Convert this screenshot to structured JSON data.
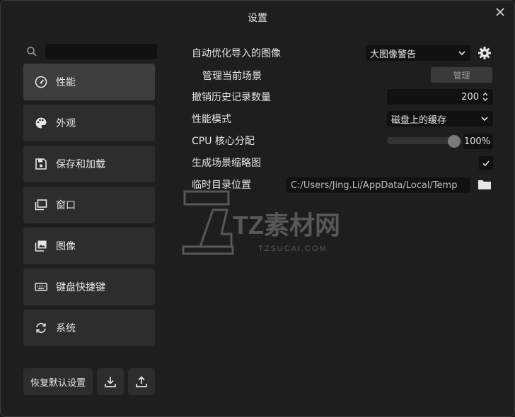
{
  "window": {
    "title": "设置"
  },
  "search": {
    "placeholder": ""
  },
  "sidebar": {
    "items": [
      {
        "label": "性能",
        "icon": "speedometer-icon"
      },
      {
        "label": "外观",
        "icon": "palette-icon"
      },
      {
        "label": "保存和加载",
        "icon": "floppy-disk-icon"
      },
      {
        "label": "窗口",
        "icon": "window-icon"
      },
      {
        "label": "图像",
        "icon": "image-icon"
      },
      {
        "label": "键盘快捷键",
        "icon": "keyboard-icon"
      },
      {
        "label": "系统",
        "icon": "refresh-icon"
      }
    ],
    "reset_label": "恢复默认设置"
  },
  "settings": {
    "auto_optimize": {
      "label": "自动优化导入的图像",
      "value": "大图像警告"
    },
    "manage_scenes": {
      "label": "管理当前场景",
      "button": "管理"
    },
    "undo_history": {
      "label": "撤销历史记录数量",
      "value": "200"
    },
    "perf_mode": {
      "label": "性能模式",
      "value": "磁盘上的缓存"
    },
    "cpu_cores": {
      "label": "CPU 核心分配",
      "value": "100%",
      "level": 1.0
    },
    "thumbnails": {
      "label": "生成场景缩略图",
      "checked": true
    },
    "temp_dir": {
      "label": "临时目录位置",
      "value": "C:/Users/Jing.Li/AppData/Local/Temp"
    }
  },
  "watermark": {
    "text": "TZ素材网",
    "sub": "TZSUCAI.COM"
  },
  "colors": {
    "bg": "#1e1e1e",
    "panel": "#2d2d2d",
    "active": "#3e3e3e",
    "field": "#111111"
  }
}
